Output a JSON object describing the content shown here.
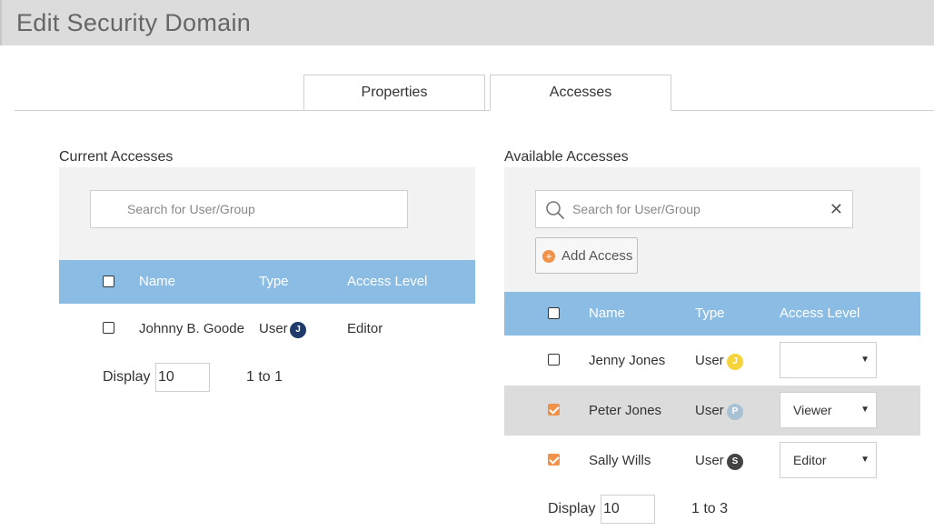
{
  "page": {
    "title": "Edit Security Domain"
  },
  "tabs": [
    {
      "label": "Properties",
      "active": false
    },
    {
      "label": "Accesses",
      "active": true
    }
  ],
  "colors": {
    "accent": "#f0924a",
    "table_header": "#8bbde4",
    "badge_user_j_current": "#1f3a6b",
    "badge_user_j_available": "#f5d33a",
    "badge_user_p": "#a9c2d3",
    "badge_user_s": "#444444"
  },
  "current": {
    "title": "Current Accesses",
    "search_placeholder": "Search for User/Group",
    "columns": {
      "name": "Name",
      "type": "Type",
      "level": "Access Level"
    },
    "rows": [
      {
        "name": "Johnny B. Goode",
        "type": "User",
        "badge": "J",
        "level": "Editor",
        "checked": false
      }
    ],
    "display_label": "Display",
    "display_value": "10",
    "range": "1 to 1"
  },
  "available": {
    "title": "Available Accesses",
    "search_placeholder": "Search for User/Group",
    "search_icon": "search-icon",
    "clear_icon": "close-icon",
    "add_label": "Add Access",
    "columns": {
      "name": "Name",
      "type": "Type",
      "level": "Access Level"
    },
    "rows": [
      {
        "name": "Jenny Jones",
        "type": "User",
        "badge": "J",
        "level": "",
        "checked": false
      },
      {
        "name": "Peter Jones",
        "type": "User",
        "badge": "P",
        "level": "Viewer",
        "checked": true
      },
      {
        "name": "Sally Wills",
        "type": "User",
        "badge": "S",
        "level": "Editor",
        "checked": true
      }
    ],
    "display_label": "Display",
    "display_value": "10",
    "range": "1 to 3"
  }
}
